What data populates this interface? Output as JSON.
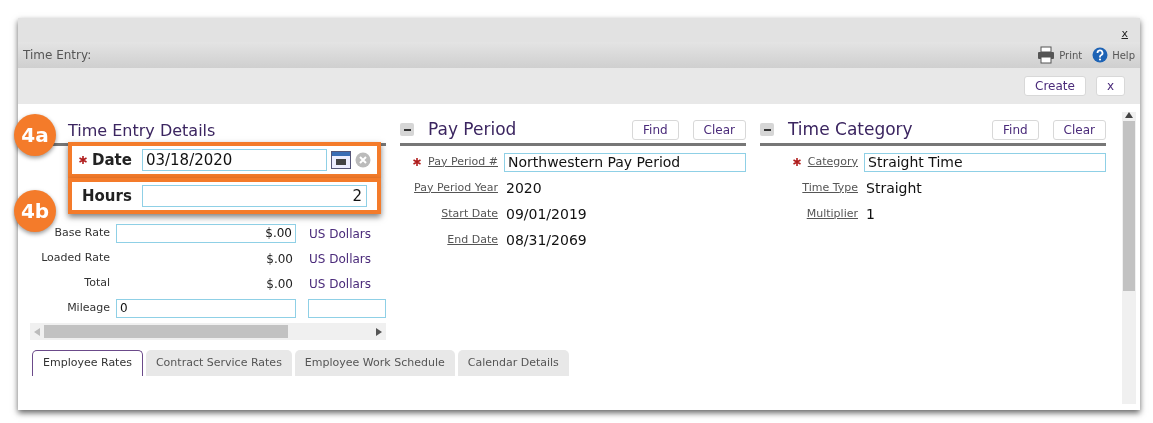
{
  "window": {
    "close_label": "x",
    "title": "Time Entry:"
  },
  "toolbar": {
    "links": [
      {
        "label": "Print",
        "kind": "print"
      },
      {
        "label": "Help",
        "kind": "help"
      }
    ],
    "buttons": [
      "Create",
      "x"
    ]
  },
  "callouts": [
    "4a",
    "4b"
  ],
  "time_entry_details": {
    "title": "Time Entry Details",
    "date": {
      "label": "Date",
      "required": true,
      "value": "03/18/2020"
    },
    "hours": {
      "label": "Hours",
      "value": "2"
    },
    "rows": [
      {
        "label": "Base Rate",
        "kind": "field",
        "value": "$.00",
        "unit": "US Dollars"
      },
      {
        "label": "Loaded Rate",
        "kind": "text",
        "value": "$.00",
        "unit": "US Dollars"
      },
      {
        "label": "Total",
        "kind": "text",
        "value": "$.00",
        "unit": "US Dollars"
      },
      {
        "label": "Mileage",
        "kind": "double_field",
        "value": "0"
      }
    ]
  },
  "sections": [
    {
      "title": "Pay Period",
      "expanded": true,
      "buttons": [
        "Find",
        "Clear"
      ],
      "rows": [
        {
          "label": "Pay Period #",
          "required": true,
          "kind": "field",
          "value": "Northwestern Pay Period"
        },
        {
          "label": "Pay Period Year",
          "required": false,
          "kind": "text",
          "value": "2020"
        },
        {
          "label": "Start Date",
          "required": false,
          "kind": "text",
          "value": "09/01/2019"
        },
        {
          "label": "End Date",
          "required": false,
          "kind": "text",
          "value": "08/31/2069"
        }
      ]
    },
    {
      "title": "Time Category",
      "expanded": true,
      "buttons": [
        "Find",
        "Clear"
      ],
      "rows": [
        {
          "label": "Category",
          "required": true,
          "kind": "field",
          "value": "Straight Time"
        },
        {
          "label": "Time Type",
          "required": false,
          "kind": "text",
          "value": "Straight"
        },
        {
          "label": "Multiplier",
          "required": false,
          "kind": "text",
          "value": "1"
        }
      ]
    }
  ],
  "tabs": [
    {
      "label": "Employee Rates",
      "selected": true
    },
    {
      "label": "Contract Service Rates",
      "selected": false
    },
    {
      "label": "Employee Work Schedule",
      "selected": false
    },
    {
      "label": "Calendar Details",
      "selected": false
    }
  ]
}
